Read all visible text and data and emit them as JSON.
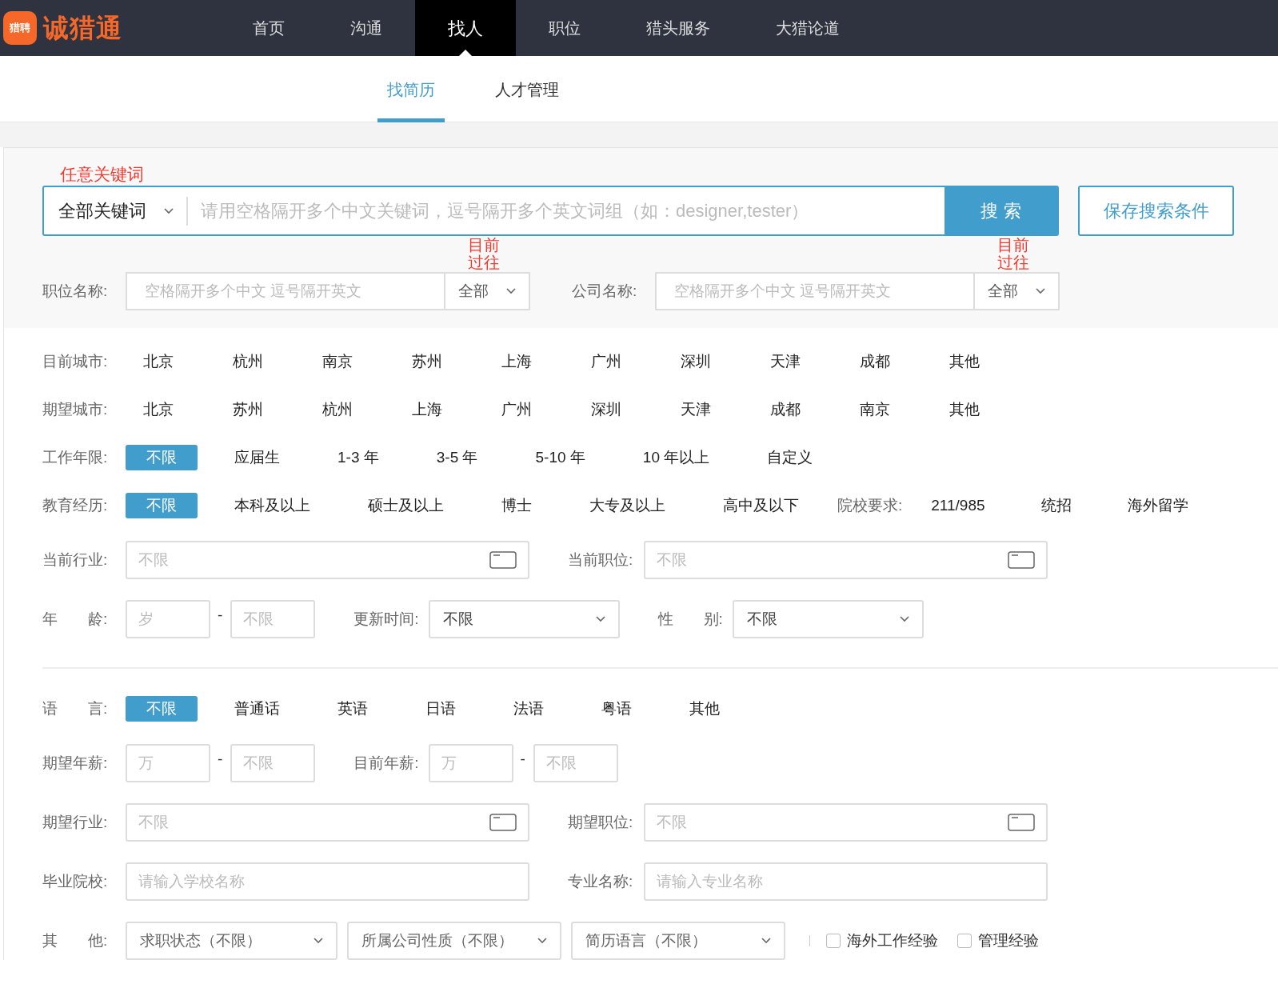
{
  "brand": {
    "badge": "猎聘",
    "name": "诚猎通"
  },
  "nav": [
    {
      "label": "首页",
      "selected": false
    },
    {
      "label": "沟通",
      "selected": false
    },
    {
      "label": "找人",
      "selected": true
    },
    {
      "label": "职位",
      "selected": false
    },
    {
      "label": "猎头服务",
      "selected": false
    },
    {
      "label": "大猎论道",
      "selected": false
    }
  ],
  "subtabs": [
    {
      "label": "找简历",
      "selected": true
    },
    {
      "label": "人才管理",
      "selected": false
    }
  ],
  "keyword_search": {
    "annotation": "任意关键词",
    "scope": "全部关键词",
    "placeholder": "请用空格隔开多个中文关键词，逗号隔开多个英文词组（如：designer,tester）",
    "button": "搜 索"
  },
  "save_button": "保存搜索条件",
  "scoped_fields": [
    {
      "label": "职位名称:",
      "placeholder": "空格隔开多个中文 逗号隔开英文",
      "scope": "全部",
      "annotation": [
        "目前",
        "过往"
      ]
    },
    {
      "label": "公司名称:",
      "placeholder": "空格隔开多个中文 逗号隔开英文",
      "scope": "全部",
      "annotation": [
        "目前",
        "过往"
      ]
    }
  ],
  "filters": [
    {
      "kind": "options",
      "label": "目前城市:",
      "options": [
        {
          "label": "北京",
          "selected": false
        },
        {
          "label": "杭州",
          "selected": false
        },
        {
          "label": "南京",
          "selected": false
        },
        {
          "label": "苏州",
          "selected": false
        },
        {
          "label": "上海",
          "selected": false
        },
        {
          "label": "广州",
          "selected": false
        },
        {
          "label": "深圳",
          "selected": false
        },
        {
          "label": "天津",
          "selected": false
        },
        {
          "label": "成都",
          "selected": false
        },
        {
          "label": "其他",
          "selected": false
        }
      ]
    },
    {
      "kind": "options",
      "label": "期望城市:",
      "options": [
        {
          "label": "北京",
          "selected": false
        },
        {
          "label": "苏州",
          "selected": false
        },
        {
          "label": "杭州",
          "selected": false
        },
        {
          "label": "上海",
          "selected": false
        },
        {
          "label": "广州",
          "selected": false
        },
        {
          "label": "深圳",
          "selected": false
        },
        {
          "label": "天津",
          "selected": false
        },
        {
          "label": "成都",
          "selected": false
        },
        {
          "label": "南京",
          "selected": false
        },
        {
          "label": "其他",
          "selected": false
        }
      ]
    },
    {
      "kind": "options",
      "label": "工作年限:",
      "options": [
        {
          "label": "不限",
          "selected": true
        },
        {
          "label": "应届生",
          "selected": false
        },
        {
          "label": "1-3 年",
          "selected": false
        },
        {
          "label": "3-5 年",
          "selected": false
        },
        {
          "label": "5-10 年",
          "selected": false
        },
        {
          "label": "10 年以上",
          "selected": false
        },
        {
          "label": "自定义",
          "selected": false
        }
      ]
    },
    {
      "kind": "options",
      "label": "教育经历:",
      "options": [
        {
          "label": "不限",
          "selected": true
        },
        {
          "label": "本科及以上",
          "selected": false
        },
        {
          "label": "硕士及以上",
          "selected": false
        },
        {
          "label": "博士",
          "selected": false
        },
        {
          "label": "大专及以上",
          "selected": false
        },
        {
          "label": "高中及以下",
          "selected": false
        }
      ],
      "extra": {
        "label": "院校要求:",
        "options": [
          {
            "label": "211/985",
            "selected": false
          },
          {
            "label": "统招",
            "selected": false
          },
          {
            "label": "海外留学",
            "selected": false
          }
        ]
      }
    },
    {
      "kind": "fields",
      "items": [
        {
          "kind": "picker",
          "label": "当前行业:",
          "placeholder": "不限"
        },
        {
          "kind": "picker",
          "label": "当前职位:",
          "placeholder": "不限"
        }
      ]
    },
    {
      "kind": "fields",
      "items": [
        {
          "kind": "range",
          "label": "年　　龄:",
          "inputs": [
            {
              "placeholder": "岁"
            },
            {
              "placeholder": "不限"
            }
          ],
          "separator": "-"
        },
        {
          "kind": "select",
          "label": "更新时间:",
          "value": "不限"
        },
        {
          "kind": "select",
          "label": "性　　别:",
          "value": "不限"
        }
      ]
    },
    {
      "kind": "rule"
    },
    {
      "kind": "options",
      "label": "语　　言:",
      "options": [
        {
          "label": "不限",
          "selected": true
        },
        {
          "label": "普通话",
          "selected": false
        },
        {
          "label": "英语",
          "selected": false
        },
        {
          "label": "日语",
          "selected": false
        },
        {
          "label": "法语",
          "selected": false
        },
        {
          "label": "粤语",
          "selected": false
        },
        {
          "label": "其他",
          "selected": false
        }
      ]
    },
    {
      "kind": "fields",
      "items": [
        {
          "kind": "range",
          "label": "期望年薪:",
          "inputs": [
            {
              "placeholder": "万"
            },
            {
              "placeholder": "不限"
            }
          ],
          "separator": "-"
        },
        {
          "kind": "range",
          "label": "目前年薪:",
          "inputs": [
            {
              "placeholder": "万"
            },
            {
              "placeholder": "不限"
            }
          ],
          "separator": "-"
        }
      ]
    },
    {
      "kind": "fields",
      "items": [
        {
          "kind": "picker",
          "label": "期望行业:",
          "placeholder": "不限"
        },
        {
          "kind": "picker",
          "label": "期望职位:",
          "placeholder": "不限"
        }
      ]
    },
    {
      "kind": "fields",
      "items": [
        {
          "kind": "text",
          "label": "毕业院校:",
          "placeholder": "请输入学校名称"
        },
        {
          "kind": "text",
          "label": "专业名称:",
          "placeholder": "请输入专业名称"
        }
      ]
    },
    {
      "kind": "fields",
      "items": [
        {
          "kind": "select",
          "label": "其　　他:",
          "value": "求职状态（不限）"
        },
        {
          "kind": "select",
          "value": "所属公司性质（不限）"
        },
        {
          "kind": "select",
          "value": "简历语言（不限）"
        },
        {
          "kind": "checkbox",
          "label": "海外工作经验",
          "checked": false
        },
        {
          "kind": "checkbox",
          "label": "管理经验",
          "checked": false
        }
      ]
    }
  ]
}
